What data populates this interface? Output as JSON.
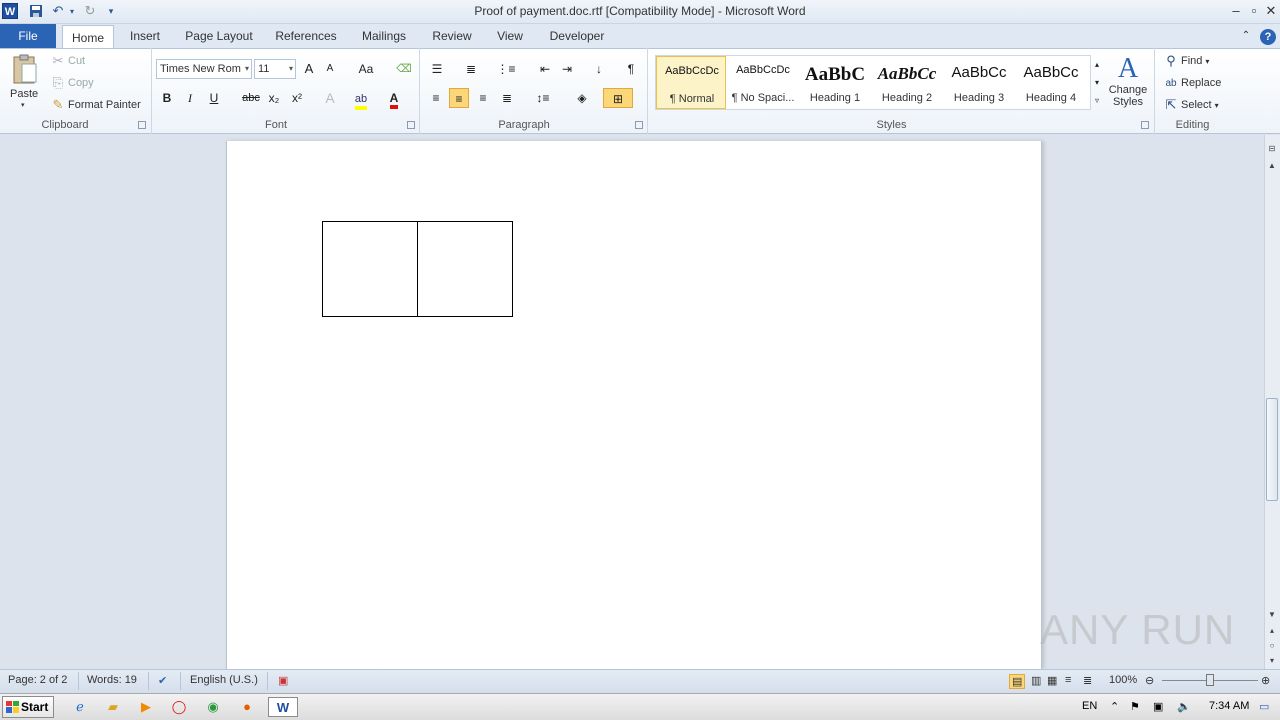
{
  "window": {
    "title": "Proof of payment.doc.rtf [Compatibility Mode] - Microsoft Word",
    "app_icon": "W"
  },
  "tabs": {
    "file": "File",
    "home": "Home",
    "insert": "Insert",
    "page_layout": "Page Layout",
    "references": "References",
    "mailings": "Mailings",
    "review": "Review",
    "view": "View",
    "developer": "Developer"
  },
  "clipboard": {
    "paste": "Paste",
    "cut": "Cut",
    "copy": "Copy",
    "format_painter": "Format Painter",
    "label": "Clipboard"
  },
  "font": {
    "name": "Times New Rom",
    "size": "11",
    "label": "Font",
    "bold": "B",
    "italic": "I",
    "underline": "U",
    "strike": "abc",
    "sub": "x₂",
    "sup": "x²",
    "grow": "A",
    "shrink": "A",
    "case": "Aa",
    "font_color": "A"
  },
  "paragraph": {
    "label": "Paragraph",
    "pilcrow": "¶"
  },
  "styles": {
    "label": "Styles",
    "items": [
      {
        "preview": "AaBbCcDc",
        "name": "¶ Normal"
      },
      {
        "preview": "AaBbCcDc",
        "name": "¶ No Spaci..."
      },
      {
        "preview": "AaBbC",
        "name": "Heading 1"
      },
      {
        "preview": "AaBbCc",
        "name": "Heading 2"
      },
      {
        "preview": "AaBbCc",
        "name": "Heading 3"
      },
      {
        "preview": "AaBbCc",
        "name": "Heading 4"
      }
    ],
    "change_styles": "Change Styles"
  },
  "editing": {
    "label": "Editing",
    "find": "Find",
    "replace": "Replace",
    "select": "Select"
  },
  "status": {
    "page": "Page: 2 of 2",
    "words": "Words: 19",
    "language": "English (U.S.)",
    "zoom": "100%",
    "zoom_level": 1.0
  },
  "taskbar": {
    "start": "Start",
    "lang": "EN",
    "time": "7:34 AM"
  },
  "watermark": "ANY RUN"
}
